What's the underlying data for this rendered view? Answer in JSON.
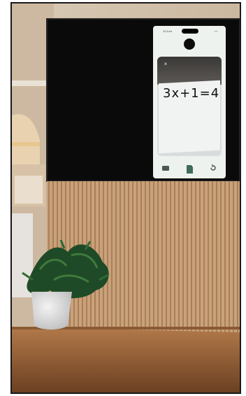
{
  "phone": {
    "status_time": "12:14 ▸",
    "status_icons": "▪ ▪",
    "close_glyph": "×",
    "equation_text": "3x+1=4"
  },
  "icons": {
    "left": "gallery-icon",
    "center": "capture-icon",
    "right": "refresh-icon"
  }
}
